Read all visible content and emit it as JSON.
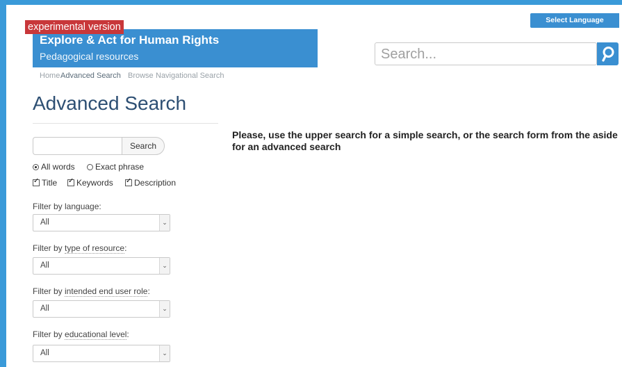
{
  "header": {
    "select_language": "Select Language",
    "experimental": "experimental version",
    "title": "Explore & Act for Human Rights",
    "subtitle": "Pedagogical resources",
    "search_placeholder": "Search..."
  },
  "breadcrumb": {
    "home": "Home",
    "advanced": "Advanced Search",
    "browse": "Browse",
    "navigational": "Navigational Search"
  },
  "page_title": "Advanced Search",
  "message": "Please, use the upper search for a simple search, or the search form from the aside for an advanced search",
  "search_form": {
    "input_value": "",
    "button_label": "Search",
    "match_modes": [
      {
        "label": "All words",
        "selected": true
      },
      {
        "label": "Exact phrase",
        "selected": false
      }
    ],
    "fields": [
      {
        "label": "Title",
        "checked": true
      },
      {
        "label": "Keywords",
        "checked": true
      },
      {
        "label": "Description",
        "checked": true
      }
    ]
  },
  "filters": [
    {
      "prefix": "Filter by ",
      "term": "language",
      "suffix": ":",
      "value": "All"
    },
    {
      "prefix": "Filter by ",
      "term": "type of resource",
      "suffix": ":",
      "value": "All"
    },
    {
      "prefix": "Filter by ",
      "term": "intended end user role",
      "suffix": ":",
      "value": "All"
    },
    {
      "prefix": "Filter by ",
      "term": "educational level",
      "suffix": ":",
      "value": "All"
    }
  ],
  "colors": {
    "brand_blue": "#3a8fd1",
    "experimental_red": "#c8373a",
    "title_navy": "#2d4f73"
  }
}
